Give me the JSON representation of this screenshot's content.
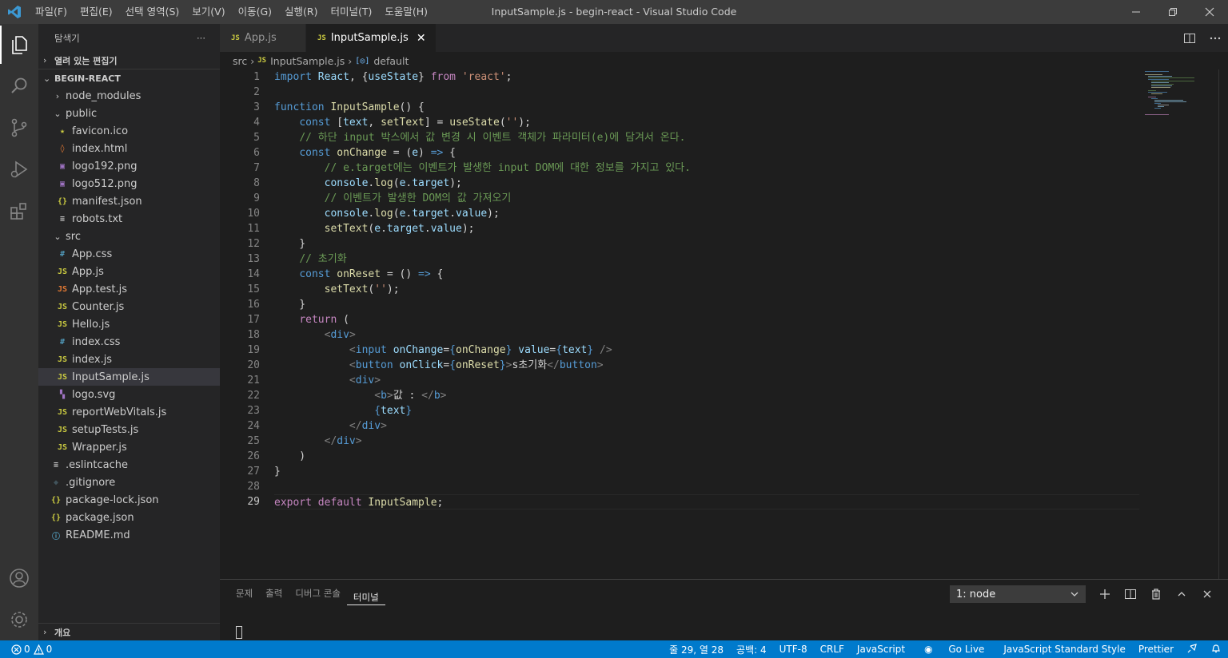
{
  "window": {
    "title": "InputSample.js - begin-react - Visual Studio Code",
    "menu": [
      "파일(F)",
      "편집(E)",
      "선택 영역(S)",
      "보기(V)",
      "이동(G)",
      "실행(R)",
      "터미널(T)",
      "도움말(H)"
    ]
  },
  "sidebar": {
    "header": "탐색기",
    "more": "···",
    "open_editors": "열려 있는 편집기",
    "project": "BEGIN-REACT",
    "outline": "개요",
    "tree": [
      {
        "label": "node_modules",
        "type": "folder",
        "chev": "›",
        "indent": 0
      },
      {
        "label": "public",
        "type": "folder",
        "chev": "⌄",
        "indent": 0
      },
      {
        "label": "favicon.ico",
        "icon": "★",
        "icon_color": "#cbcb41",
        "indent": 1
      },
      {
        "label": "index.html",
        "icon": "◊",
        "icon_color": "#e37933",
        "indent": 1
      },
      {
        "label": "logo192.png",
        "icon": "▣",
        "icon_color": "#a074c4",
        "indent": 1
      },
      {
        "label": "logo512.png",
        "icon": "▣",
        "icon_color": "#a074c4",
        "indent": 1
      },
      {
        "label": "manifest.json",
        "icon": "{}",
        "icon_color": "#cbcb41",
        "indent": 1
      },
      {
        "label": "robots.txt",
        "icon": "≡",
        "icon_color": "#cccccc",
        "indent": 1
      },
      {
        "label": "src",
        "type": "folder",
        "chev": "⌄",
        "indent": 0
      },
      {
        "label": "App.css",
        "icon": "#",
        "icon_color": "#519aba",
        "indent": 1
      },
      {
        "label": "App.js",
        "icon": "JS",
        "icon_color": "#cbcb41",
        "indent": 1
      },
      {
        "label": "App.test.js",
        "icon": "JS",
        "icon_color": "#e37933",
        "indent": 1
      },
      {
        "label": "Counter.js",
        "icon": "JS",
        "icon_color": "#cbcb41",
        "indent": 1
      },
      {
        "label": "Hello.js",
        "icon": "JS",
        "icon_color": "#cbcb41",
        "indent": 1
      },
      {
        "label": "index.css",
        "icon": "#",
        "icon_color": "#519aba",
        "indent": 1
      },
      {
        "label": "index.js",
        "icon": "JS",
        "icon_color": "#cbcb41",
        "indent": 1
      },
      {
        "label": "InputSample.js",
        "icon": "JS",
        "icon_color": "#cbcb41",
        "indent": 1,
        "selected": true
      },
      {
        "label": "logo.svg",
        "icon": "▚",
        "icon_color": "#a074c4",
        "indent": 1
      },
      {
        "label": "reportWebVitals.js",
        "icon": "JS",
        "icon_color": "#cbcb41",
        "indent": 1
      },
      {
        "label": "setupTests.js",
        "icon": "JS",
        "icon_color": "#cbcb41",
        "indent": 1
      },
      {
        "label": "Wrapper.js",
        "icon": "JS",
        "icon_color": "#cbcb41",
        "indent": 1
      },
      {
        "label": ".eslintcache",
        "icon": "≡",
        "icon_color": "#cccccc",
        "indent": 0
      },
      {
        "label": ".gitignore",
        "icon": "◆",
        "icon_color": "#41535b",
        "indent": 0
      },
      {
        "label": "package-lock.json",
        "icon": "{}",
        "icon_color": "#cbcb41",
        "indent": 0
      },
      {
        "label": "package.json",
        "icon": "{}",
        "icon_color": "#cbcb41",
        "indent": 0
      },
      {
        "label": "README.md",
        "icon": "ⓘ",
        "icon_color": "#519aba",
        "indent": 0
      }
    ]
  },
  "tabs": [
    {
      "label": "App.js",
      "badge": "JS",
      "active": false
    },
    {
      "label": "InputSample.js",
      "badge": "JS",
      "active": true
    }
  ],
  "breadcrumb": {
    "folder": "src",
    "file": "InputSample.js",
    "badge": "JS",
    "symbol": "default"
  },
  "editor": {
    "current_line": 29,
    "lines": [
      [
        [
          "kw",
          "import"
        ],
        [
          "pun",
          " "
        ],
        [
          "var",
          "React"
        ],
        [
          "pun",
          ", {"
        ],
        [
          "var",
          "useState"
        ],
        [
          "pun",
          "} "
        ],
        [
          "ctl",
          "from"
        ],
        [
          "pun",
          " "
        ],
        [
          "str",
          "'react'"
        ],
        [
          "pun",
          ";"
        ]
      ],
      [],
      [
        [
          "kw",
          "function"
        ],
        [
          "pun",
          " "
        ],
        [
          "fn",
          "InputSample"
        ],
        [
          "pun",
          "() {"
        ]
      ],
      [
        [
          "pun",
          "    "
        ],
        [
          "kw",
          "const"
        ],
        [
          "pun",
          " ["
        ],
        [
          "var",
          "text"
        ],
        [
          "pun",
          ", "
        ],
        [
          "fn",
          "setText"
        ],
        [
          "pun",
          "] = "
        ],
        [
          "fn",
          "useState"
        ],
        [
          "pun",
          "("
        ],
        [
          "str",
          "''"
        ],
        [
          "pun",
          ");"
        ]
      ],
      [
        [
          "pun",
          "    "
        ],
        [
          "cm",
          "// 하단 input 박스에서 값 변경 시 이벤트 객체가 파라미터(e)에 담겨서 온다."
        ]
      ],
      [
        [
          "pun",
          "    "
        ],
        [
          "kw",
          "const"
        ],
        [
          "pun",
          " "
        ],
        [
          "fn",
          "onChange"
        ],
        [
          "pun",
          " = ("
        ],
        [
          "var",
          "e"
        ],
        [
          "pun",
          ") "
        ],
        [
          "kw",
          "=>"
        ],
        [
          "pun",
          " {"
        ]
      ],
      [
        [
          "pun",
          "        "
        ],
        [
          "cm",
          "// e.target에는 이벤트가 발생한 input DOM에 대한 정보를 가지고 있다."
        ]
      ],
      [
        [
          "pun",
          "        "
        ],
        [
          "var",
          "console"
        ],
        [
          "pun",
          "."
        ],
        [
          "fn",
          "log"
        ],
        [
          "pun",
          "("
        ],
        [
          "var",
          "e"
        ],
        [
          "pun",
          "."
        ],
        [
          "var",
          "target"
        ],
        [
          "pun",
          ");"
        ]
      ],
      [
        [
          "pun",
          "        "
        ],
        [
          "cm",
          "// 이벤트가 발생한 DOM의 값 가져오기"
        ]
      ],
      [
        [
          "pun",
          "        "
        ],
        [
          "var",
          "console"
        ],
        [
          "pun",
          "."
        ],
        [
          "fn",
          "log"
        ],
        [
          "pun",
          "("
        ],
        [
          "var",
          "e"
        ],
        [
          "pun",
          "."
        ],
        [
          "var",
          "target"
        ],
        [
          "pun",
          "."
        ],
        [
          "var",
          "value"
        ],
        [
          "pun",
          ");"
        ]
      ],
      [
        [
          "pun",
          "        "
        ],
        [
          "fn",
          "setText"
        ],
        [
          "pun",
          "("
        ],
        [
          "var",
          "e"
        ],
        [
          "pun",
          "."
        ],
        [
          "var",
          "target"
        ],
        [
          "pun",
          "."
        ],
        [
          "var",
          "value"
        ],
        [
          "pun",
          ");"
        ]
      ],
      [
        [
          "pun",
          "    }"
        ]
      ],
      [
        [
          "pun",
          "    "
        ],
        [
          "cm",
          "// 초기화"
        ]
      ],
      [
        [
          "pun",
          "    "
        ],
        [
          "kw",
          "const"
        ],
        [
          "pun",
          " "
        ],
        [
          "fn",
          "onReset"
        ],
        [
          "pun",
          " = () "
        ],
        [
          "kw",
          "=>"
        ],
        [
          "pun",
          " {"
        ]
      ],
      [
        [
          "pun",
          "        "
        ],
        [
          "fn",
          "setText"
        ],
        [
          "pun",
          "("
        ],
        [
          "str",
          "''"
        ],
        [
          "pun",
          ");"
        ]
      ],
      [
        [
          "pun",
          "    }"
        ]
      ],
      [
        [
          "pun",
          "    "
        ],
        [
          "ctl",
          "return"
        ],
        [
          "pun",
          " ("
        ]
      ],
      [
        [
          "pun",
          "        "
        ],
        [
          "tp",
          "<"
        ],
        [
          "tag",
          "div"
        ],
        [
          "tp",
          ">"
        ]
      ],
      [
        [
          "pun",
          "            "
        ],
        [
          "tp",
          "<"
        ],
        [
          "tag",
          "input"
        ],
        [
          "pun",
          " "
        ],
        [
          "var",
          "onChange"
        ],
        [
          "pun",
          "="
        ],
        [
          "kw",
          "{"
        ],
        [
          "fn",
          "onChange"
        ],
        [
          "kw",
          "}"
        ],
        [
          "pun",
          " "
        ],
        [
          "var",
          "value"
        ],
        [
          "pun",
          "="
        ],
        [
          "kw",
          "{"
        ],
        [
          "var",
          "text"
        ],
        [
          "kw",
          "}"
        ],
        [
          "pun",
          " "
        ],
        [
          "tp",
          "/>"
        ]
      ],
      [
        [
          "pun",
          "            "
        ],
        [
          "tp",
          "<"
        ],
        [
          "tag",
          "button"
        ],
        [
          "pun",
          " "
        ],
        [
          "var",
          "onClick"
        ],
        [
          "pun",
          "="
        ],
        [
          "kw",
          "{"
        ],
        [
          "fn",
          "onReset"
        ],
        [
          "kw",
          "}"
        ],
        [
          "tp",
          ">"
        ],
        [
          "txt",
          "s초기화"
        ],
        [
          "tp",
          "</"
        ],
        [
          "tag",
          "button"
        ],
        [
          "tp",
          ">"
        ]
      ],
      [
        [
          "pun",
          "            "
        ],
        [
          "tp",
          "<"
        ],
        [
          "tag",
          "div"
        ],
        [
          "tp",
          ">"
        ]
      ],
      [
        [
          "pun",
          "                "
        ],
        [
          "tp",
          "<"
        ],
        [
          "tag",
          "b"
        ],
        [
          "tp",
          ">"
        ],
        [
          "txt",
          "값 : "
        ],
        [
          "tp",
          "</"
        ],
        [
          "tag",
          "b"
        ],
        [
          "tp",
          ">"
        ]
      ],
      [
        [
          "pun",
          "                "
        ],
        [
          "kw",
          "{"
        ],
        [
          "var",
          "text"
        ],
        [
          "kw",
          "}"
        ]
      ],
      [
        [
          "pun",
          "            "
        ],
        [
          "tp",
          "</"
        ],
        [
          "tag",
          "div"
        ],
        [
          "tp",
          ">"
        ]
      ],
      [
        [
          "pun",
          "        "
        ],
        [
          "tp",
          "</"
        ],
        [
          "tag",
          "div"
        ],
        [
          "tp",
          ">"
        ]
      ],
      [
        [
          "pun",
          "    )"
        ]
      ],
      [
        [
          "pun",
          "}"
        ]
      ],
      [],
      [
        [
          "ctl",
          "export"
        ],
        [
          "pun",
          " "
        ],
        [
          "ctl",
          "default"
        ],
        [
          "pun",
          " "
        ],
        [
          "fn",
          "InputSample"
        ],
        [
          "pun",
          ";"
        ]
      ]
    ]
  },
  "panel": {
    "tabs": [
      "문제",
      "출력",
      "디버그 콘솔",
      "터미널"
    ],
    "active_tab": "터미널",
    "terminal_select": "1: node"
  },
  "statusbar": {
    "errors": "0",
    "warnings": "0",
    "position": "줄 29, 열 28",
    "spaces": "공백: 4",
    "encoding": "UTF-8",
    "eol": "CRLF",
    "language": "JavaScript",
    "golive": "Go Live",
    "linter": "JavaScript Standard Style",
    "formatter": "Prettier"
  },
  "colors": {
    "accent": "#007acc",
    "keyword": "#569cd6",
    "control": "#c586c0",
    "function": "#dcdcaa",
    "variable": "#9cdcfe",
    "string": "#ce9178",
    "comment": "#6a9955"
  },
  "icons": [
    "vscode-logo-icon",
    "files-icon",
    "search-icon",
    "source-control-icon",
    "run-debug-icon",
    "extensions-icon",
    "account-icon",
    "gear-icon"
  ]
}
